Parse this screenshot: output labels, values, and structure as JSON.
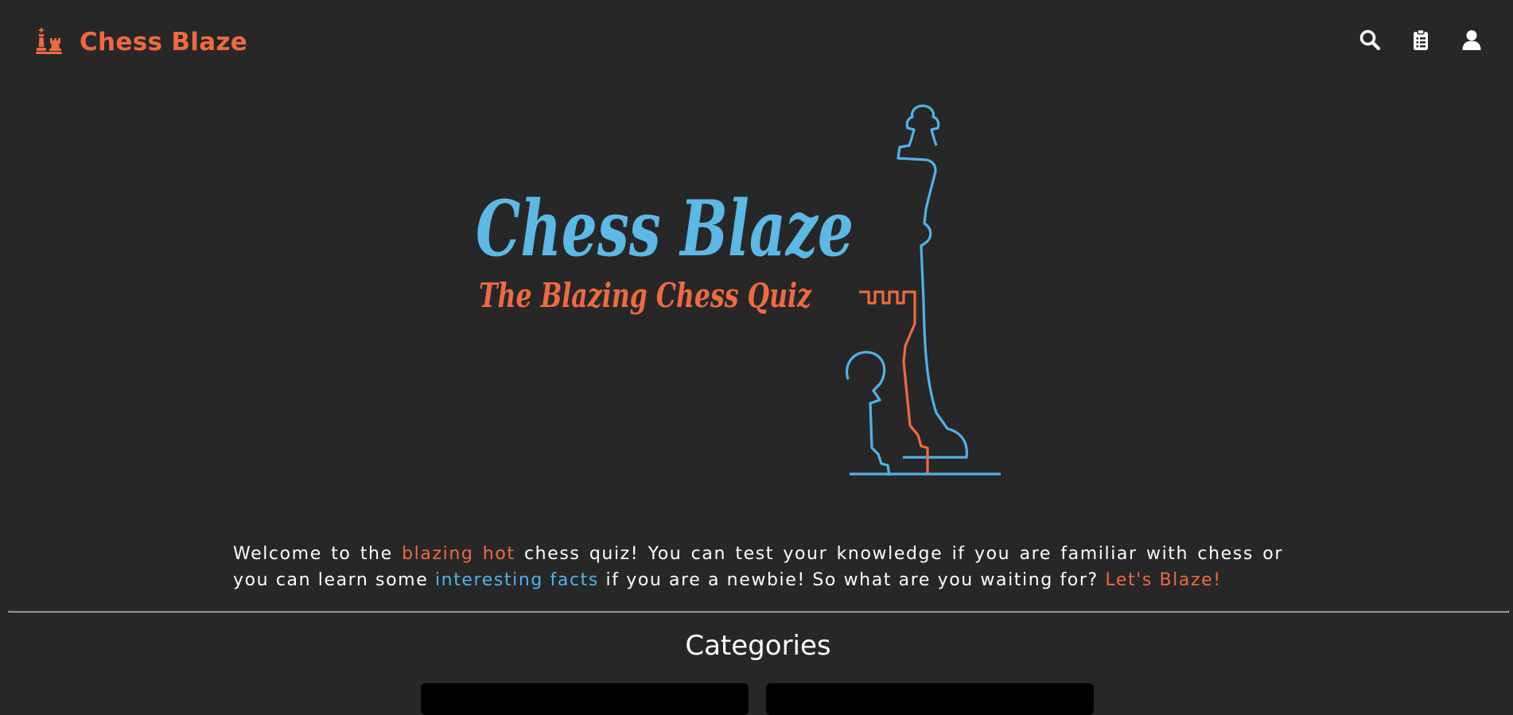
{
  "navbar": {
    "brand_name": "Chess Blaze",
    "brand_icon": "chess-pieces-icon",
    "icons": [
      "search-icon",
      "clipboard-icon",
      "user-icon"
    ]
  },
  "hero": {
    "title": "Chess Blaze",
    "subtitle": "The Blazing Chess Quiz"
  },
  "intro": {
    "part1": "Welcome to the ",
    "highlight1": "blazing hot",
    "part2": " chess quiz! You can test your knowledge if you are familiar with chess or you can learn some ",
    "highlight2": "interesting facts",
    "part3": " if you are a newbie! So what are you waiting for? ",
    "highlight3": "Let's Blaze!"
  },
  "categories": {
    "title": "Categories"
  },
  "colors": {
    "background": "#272727",
    "accent_orange": "#ee6a40",
    "accent_blue": "#4fb3e8",
    "text": "#ffffff"
  }
}
